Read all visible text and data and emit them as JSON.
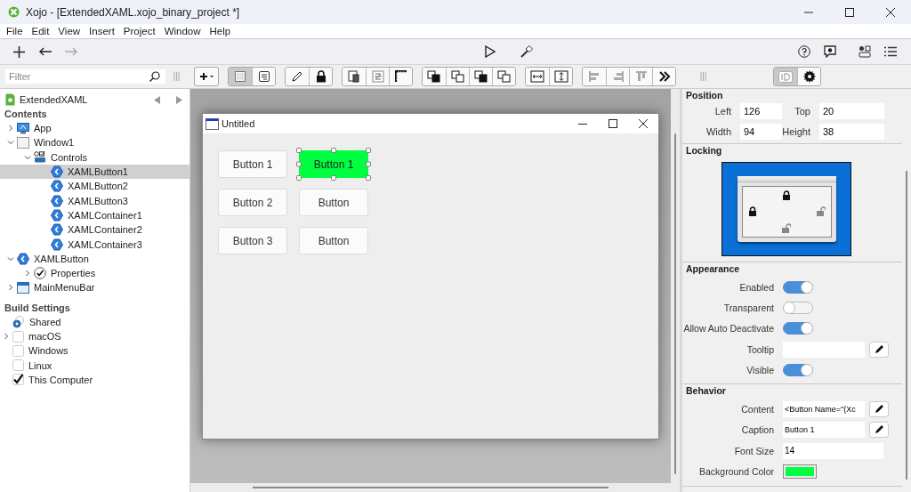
{
  "window": {
    "title": "Xojo - [ExtendedXAML.xojo_binary_project *]"
  },
  "menu": [
    "File",
    "Edit",
    "View",
    "Insert",
    "Project",
    "Window",
    "Help"
  ],
  "filter": {
    "placeholder": "Filter"
  },
  "layout_modes": [
    {
      "selected": true
    },
    {
      "selected": false
    }
  ],
  "inspector_tabs": [
    {
      "selected": true
    },
    {
      "selected": false
    }
  ],
  "navigator": {
    "project": "ExtendedXAML"
  },
  "contents": {
    "title": "Contents",
    "tree": [
      {
        "label": "App",
        "kind": "app",
        "expanded": false,
        "selected": false
      },
      {
        "label": "Window1",
        "kind": "window",
        "expanded": true,
        "selected": false,
        "children": [
          {
            "label": "Controls",
            "kind": "controls",
            "expanded": true,
            "selected": false,
            "children": [
              {
                "label": "XAMLButton1",
                "kind": "xaml",
                "selected": true
              },
              {
                "label": "XAMLButton2",
                "kind": "xaml",
                "selected": false
              },
              {
                "label": "XAMLButton3",
                "kind": "xaml",
                "selected": false
              },
              {
                "label": "XAMLContainer1",
                "kind": "xaml",
                "selected": false
              },
              {
                "label": "XAMLContainer2",
                "kind": "xaml",
                "selected": false
              },
              {
                "label": "XAMLContainer3",
                "kind": "xaml",
                "selected": false
              }
            ]
          }
        ]
      },
      {
        "label": "XAMLButton",
        "kind": "xaml",
        "expanded": true,
        "selected": false,
        "children": [
          {
            "label": "Properties",
            "kind": "properties",
            "expanded": false,
            "selected": false
          }
        ]
      },
      {
        "label": "MainMenuBar",
        "kind": "menubar",
        "expanded": false,
        "selected": false
      }
    ]
  },
  "build_settings": {
    "title": "Build Settings",
    "items": [
      {
        "label": "Shared",
        "kind": "radio",
        "checked": true
      },
      {
        "label": "macOS",
        "kind": "checkbox",
        "checked": false,
        "expanded": false
      },
      {
        "label": "Windows",
        "kind": "checkbox",
        "checked": false
      },
      {
        "label": "Linux",
        "kind": "checkbox",
        "checked": false
      },
      {
        "label": "This Computer",
        "kind": "checkbox",
        "checked": true
      }
    ]
  },
  "designer": {
    "title": "Untitled",
    "buttons": [
      {
        "label": "Button 1",
        "selected": false
      },
      {
        "label": "Button 1",
        "selected": true,
        "color": "#00ff40"
      },
      {
        "label": "Button 2",
        "selected": false
      },
      {
        "label": "Button",
        "selected": false
      },
      {
        "label": "Button 3",
        "selected": false
      },
      {
        "label": "Button",
        "selected": false
      }
    ]
  },
  "inspector": {
    "position": {
      "title": "Position",
      "fields": [
        {
          "label": "Left",
          "value": "126"
        },
        {
          "label": "Top",
          "value": "20"
        },
        {
          "label": "Width",
          "value": "94"
        },
        {
          "label": "Height",
          "value": "38"
        }
      ]
    },
    "locking": {
      "title": "Locking",
      "top": true,
      "left": true,
      "right": false,
      "bottom": false
    },
    "appearance": {
      "title": "Appearance",
      "rows": [
        {
          "label": "Enabled",
          "kind": "toggle",
          "on": true
        },
        {
          "label": "Transparent",
          "kind": "toggle",
          "on": false
        },
        {
          "label": "Allow Auto Deactivate",
          "kind": "toggle",
          "on": true
        },
        {
          "label": "Tooltip",
          "kind": "text-edit"
        },
        {
          "label": "Visible",
          "kind": "toggle",
          "on": true
        }
      ]
    },
    "behavior": {
      "title": "Behavior",
      "rows": [
        {
          "label": "Content",
          "kind": "text-edit",
          "value": "<Button Name=\"(Xc"
        },
        {
          "label": "Caption",
          "kind": "text-edit",
          "value": "Button 1"
        },
        {
          "label": "Font Size",
          "kind": "text",
          "value": "14"
        },
        {
          "label": "Background Color",
          "kind": "color",
          "color": "#00ff40"
        }
      ]
    }
  }
}
